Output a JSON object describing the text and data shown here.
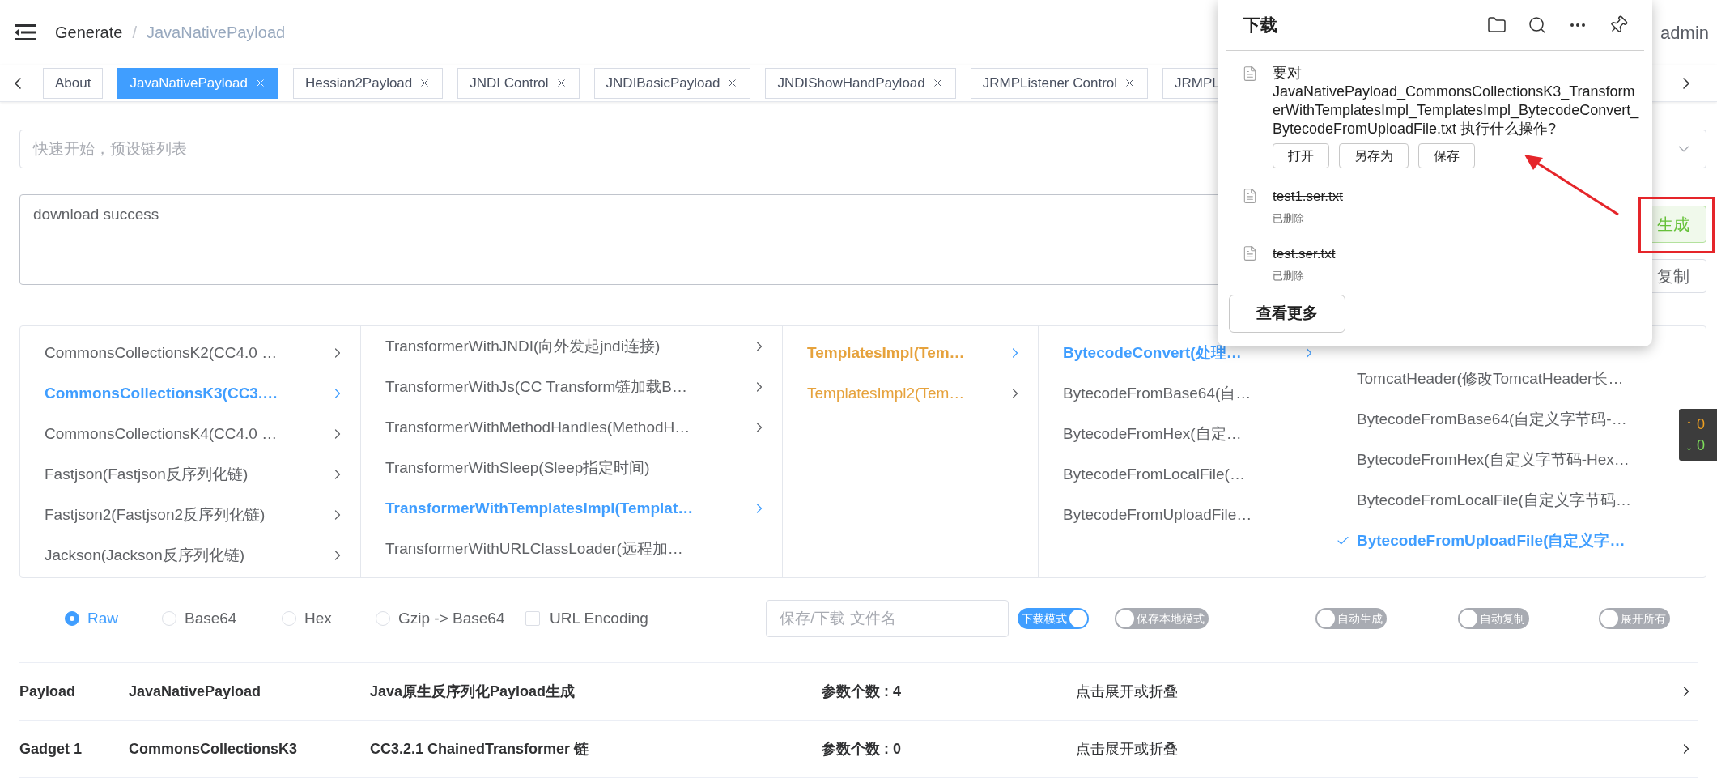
{
  "header": {
    "breadcrumb": [
      "Generate",
      "JavaNativePayload"
    ],
    "separator": "/",
    "user": "admin"
  },
  "tabs": [
    {
      "label": "About",
      "closable": false,
      "selected": false
    },
    {
      "label": "JavaNativePayload",
      "closable": true,
      "selected": true
    },
    {
      "label": "Hessian2Payload",
      "closable": true,
      "selected": false
    },
    {
      "label": "JNDI Control",
      "closable": true,
      "selected": false
    },
    {
      "label": "JNDIBasicPayload",
      "closable": true,
      "selected": false
    },
    {
      "label": "JNDIShowHandPayload",
      "closable": true,
      "selected": false
    },
    {
      "label": "JRMPListener Control",
      "closable": true,
      "selected": false
    },
    {
      "label": "JRMPL",
      "closable": false,
      "selected": false
    }
  ],
  "quick_start": {
    "placeholder": "快速开始，预设链列表"
  },
  "output": {
    "value": "download success"
  },
  "actions": {
    "generate": "生成",
    "copy": "复制"
  },
  "cascader": [
    {
      "items": [
        {
          "label": "CommonsCollectionsK2(CC4.0 …",
          "selected": false,
          "has_children": true
        },
        {
          "label": "CommonsCollectionsK3(CC3.…",
          "selected": true,
          "has_children": true
        },
        {
          "label": "CommonsCollectionsK4(CC4.0 …",
          "selected": false,
          "has_children": true
        },
        {
          "label": "Fastjson(Fastjson反序列化链)",
          "selected": false,
          "has_children": true
        },
        {
          "label": "Fastjson2(Fastjson2反序列化链)",
          "selected": false,
          "has_children": true
        },
        {
          "label": "Jackson(Jackson反序列化链)",
          "selected": false,
          "has_children": true
        }
      ]
    },
    {
      "items": [
        {
          "label": "TransformerWithJNDI(向外发起jndi连接)",
          "selected": false,
          "has_children": true
        },
        {
          "label": "TransformerWithJs(CC Transform链加载B…",
          "selected": false,
          "has_children": true
        },
        {
          "label": "TransformerWithMethodHandles(MethodH…",
          "selected": false,
          "has_children": true
        },
        {
          "label": "TransformerWithSleep(Sleep指定时间)",
          "selected": false,
          "has_children": false
        },
        {
          "label": "TransformerWithTemplatesImpl(Templat…",
          "selected": true,
          "has_children": true
        },
        {
          "label": "TransformerWithURLClassLoader(远程加…",
          "selected": false,
          "has_children": false
        }
      ]
    },
    {
      "items": [
        {
          "label": "TemplatesImpl(Tem…",
          "selected": true,
          "has_children": true,
          "color": "#e6a23c"
        },
        {
          "label": "TemplatesImpl2(Tem…",
          "selected": false,
          "has_children": true,
          "color": "#e6a23c"
        }
      ]
    },
    {
      "items": [
        {
          "label": "BytecodeConvert(处理…",
          "selected": true,
          "has_children": true
        },
        {
          "label": "BytecodeFromBase64(自…",
          "selected": false,
          "has_children": false
        },
        {
          "label": "BytecodeFromHex(自定…",
          "selected": false,
          "has_children": false
        },
        {
          "label": "BytecodeFromLocalFile(…",
          "selected": false,
          "has_children": false
        },
        {
          "label": "BytecodeFromUploadFile…",
          "selected": false,
          "has_children": false
        }
      ]
    },
    {
      "items": [
        {
          "label": "TomcatHeader(修改TomcatHeader长…",
          "selected": false,
          "has_children": false
        },
        {
          "label": "BytecodeFromBase64(自定义字节码-…",
          "selected": false,
          "has_children": false
        },
        {
          "label": "BytecodeFromHex(自定义字节码-Hex…",
          "selected": false,
          "has_children": false
        },
        {
          "label": "BytecodeFromLocalFile(自定义字节码…",
          "selected": false,
          "has_children": false
        },
        {
          "label": "BytecodeFromUploadFile(自定义字…",
          "selected": true,
          "has_children": false
        }
      ]
    }
  ],
  "encodings": [
    {
      "label": "Raw",
      "selected": true
    },
    {
      "label": "Base64",
      "selected": false
    },
    {
      "label": "Hex",
      "selected": false
    },
    {
      "label": "Gzip -> Base64",
      "selected": false
    }
  ],
  "url_encoding": {
    "label": "URL Encoding",
    "checked": false
  },
  "filename": {
    "placeholder": "保存/下载 文件名"
  },
  "toggles": [
    {
      "label": "下载模式",
      "on": true
    },
    {
      "label": "保存本地模式",
      "on": false
    },
    {
      "label": "自动生成",
      "on": false
    },
    {
      "label": "自动复制",
      "on": false
    },
    {
      "label": "展开所有",
      "on": false
    }
  ],
  "rows": [
    {
      "cells": [
        "Payload",
        "JavaNativePayload",
        "Java原生反序列化Payload生成",
        "参数个数 : 4",
        "点击展开或折叠"
      ]
    },
    {
      "cells": [
        "Gadget 1",
        "CommonsCollectionsK3",
        "CC3.2.1 ChainedTransformer 链",
        "参数个数 : 0",
        "点击展开或折叠"
      ]
    }
  ],
  "downloads": {
    "title": "下载",
    "prompt": {
      "text": "要对 JavaNativePayload_CommonsCollectionsK3_TransformerWithTemplatesImpl_TemplatesImpl_BytecodeConvert_BytecodeFromUploadFile.txt 执行什么操作?",
      "actions": [
        "打开",
        "另存为",
        "保存"
      ]
    },
    "files": [
      {
        "name": "test1.ser.txt",
        "deleted": true,
        "status": "已删除"
      },
      {
        "name": "test.ser.txt",
        "deleted": true,
        "status": "已删除"
      }
    ],
    "more": "查看更多"
  },
  "speed": {
    "up": "↑ 0",
    "down": "↓ 0"
  }
}
